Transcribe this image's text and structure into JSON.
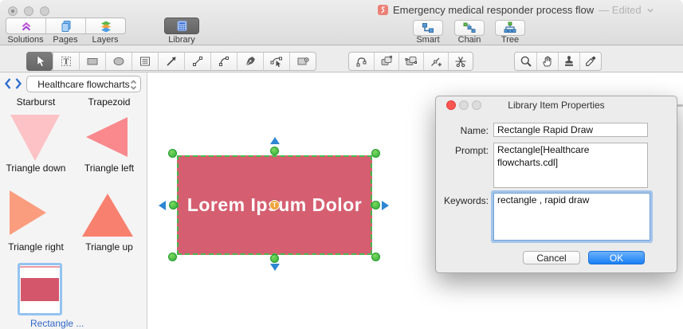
{
  "window": {
    "title": "Emergency medical responder process flow",
    "edited": "— Edited"
  },
  "toolbar": {
    "solutions_label": "Solutions",
    "pages_label": "Pages",
    "layers_label": "Layers",
    "library_label": "Library",
    "smart_label": "Smart",
    "chain_label": "Chain",
    "tree_label": "Tree"
  },
  "tools": {
    "icons": [
      "pointer-tool",
      "text-tool",
      "rectangle-tool",
      "ellipse-tool",
      "textblock-tool",
      "arrow-tool",
      "line-tool",
      "arc-tool",
      "pen-tool",
      "node-edit-tool",
      "hotspot-tool",
      "spline-tool",
      "group-tool",
      "ungroup-tool",
      "add-point-tool",
      "split-tool",
      "zoom-tool",
      "pan-tool",
      "stamp-tool",
      "eyedropper-tool",
      "zoom-out-control",
      "zoom-slider"
    ],
    "text_tool_glyph": "T"
  },
  "sidebar": {
    "dropdown_value": "Healthcare flowcharts",
    "items": [
      {
        "label": "Starburst"
      },
      {
        "label": "Trapezoid"
      },
      {
        "label": "Triangle down",
        "color": "#fcc2c5"
      },
      {
        "label": "Triangle left",
        "color": "#f9898d"
      },
      {
        "label": "Triangle right",
        "color": "#fa9d7f"
      },
      {
        "label": "Triangle up",
        "color": "#f8806f"
      },
      {
        "label": "Rectangle ...",
        "color": "#d4566b",
        "topline": "#eb9aa5"
      }
    ]
  },
  "canvas": {
    "shape_text": "Lorem Ipsum Dolor",
    "shape_fill": "#d55f71",
    "badge_glyph": "T",
    "selection_green": "#47b94c",
    "arrow_blue": "#2e86d3"
  },
  "dialog": {
    "title": "Library Item Properties",
    "name_label": "Name:",
    "name_value": "Rectangle Rapid Draw",
    "prompt_label": "Prompt:",
    "prompt_value": "Rectangle[Healthcare flowcharts.cdl]",
    "keywords_label": "Keywords:",
    "keywords_value": "rectangle , rapid draw",
    "cancel_label": "Cancel",
    "ok_label": "OK",
    "ok_color": "#2f8df6"
  }
}
